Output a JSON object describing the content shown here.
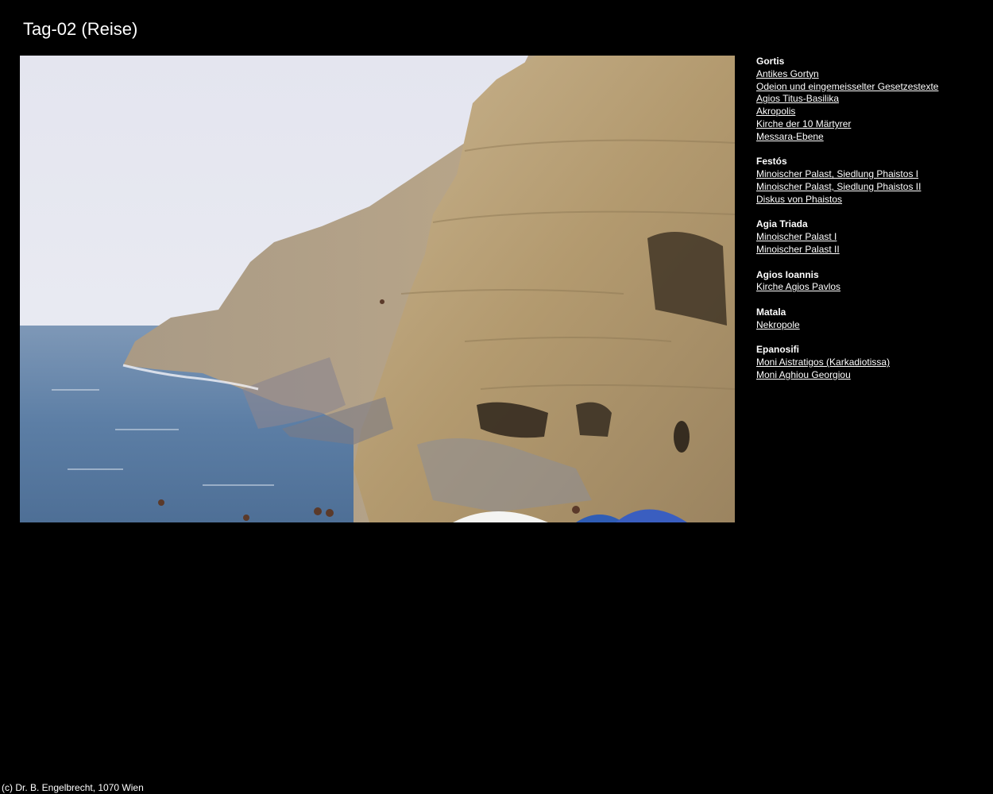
{
  "page": {
    "title": "Tag-02 (Reise)",
    "footer": "(c) Dr. B. Engelbrecht, 1070 Wien"
  },
  "photo": {
    "description_icon": "photo-image",
    "sky_color": "#e6e7f1",
    "sea_color": "#5e7fa6",
    "rock_color": "#b69a6e"
  },
  "nav": {
    "groups": [
      {
        "title": "Gortis",
        "links": [
          "Antikes Gortyn",
          "Odeion und eingemeisselter Gesetzestexte",
          "Agios Titus-Basilika",
          "Akropolis",
          "Kirche der 10 Märtyrer",
          "Messara-Ebene"
        ]
      },
      {
        "title": "Festós",
        "links": [
          "Minoischer Palast, Siedlung Phaistos I",
          "Minoischer Palast, Siedlung Phaistos II",
          "Diskus von Phaistos"
        ]
      },
      {
        "title": "Agia Triada",
        "links": [
          "Minoischer Palast I",
          "Minoischer Palast II"
        ]
      },
      {
        "title": "Agios Ioannis",
        "links": [
          "Kirche Agios Pavlos"
        ]
      },
      {
        "title": "Matala",
        "links": [
          "Nekropole"
        ]
      },
      {
        "title": "Epanosifi",
        "links": [
          "Moni Aistratigos (Karkadiotissa)",
          "Moni Aghiou Georgiou"
        ]
      }
    ]
  }
}
